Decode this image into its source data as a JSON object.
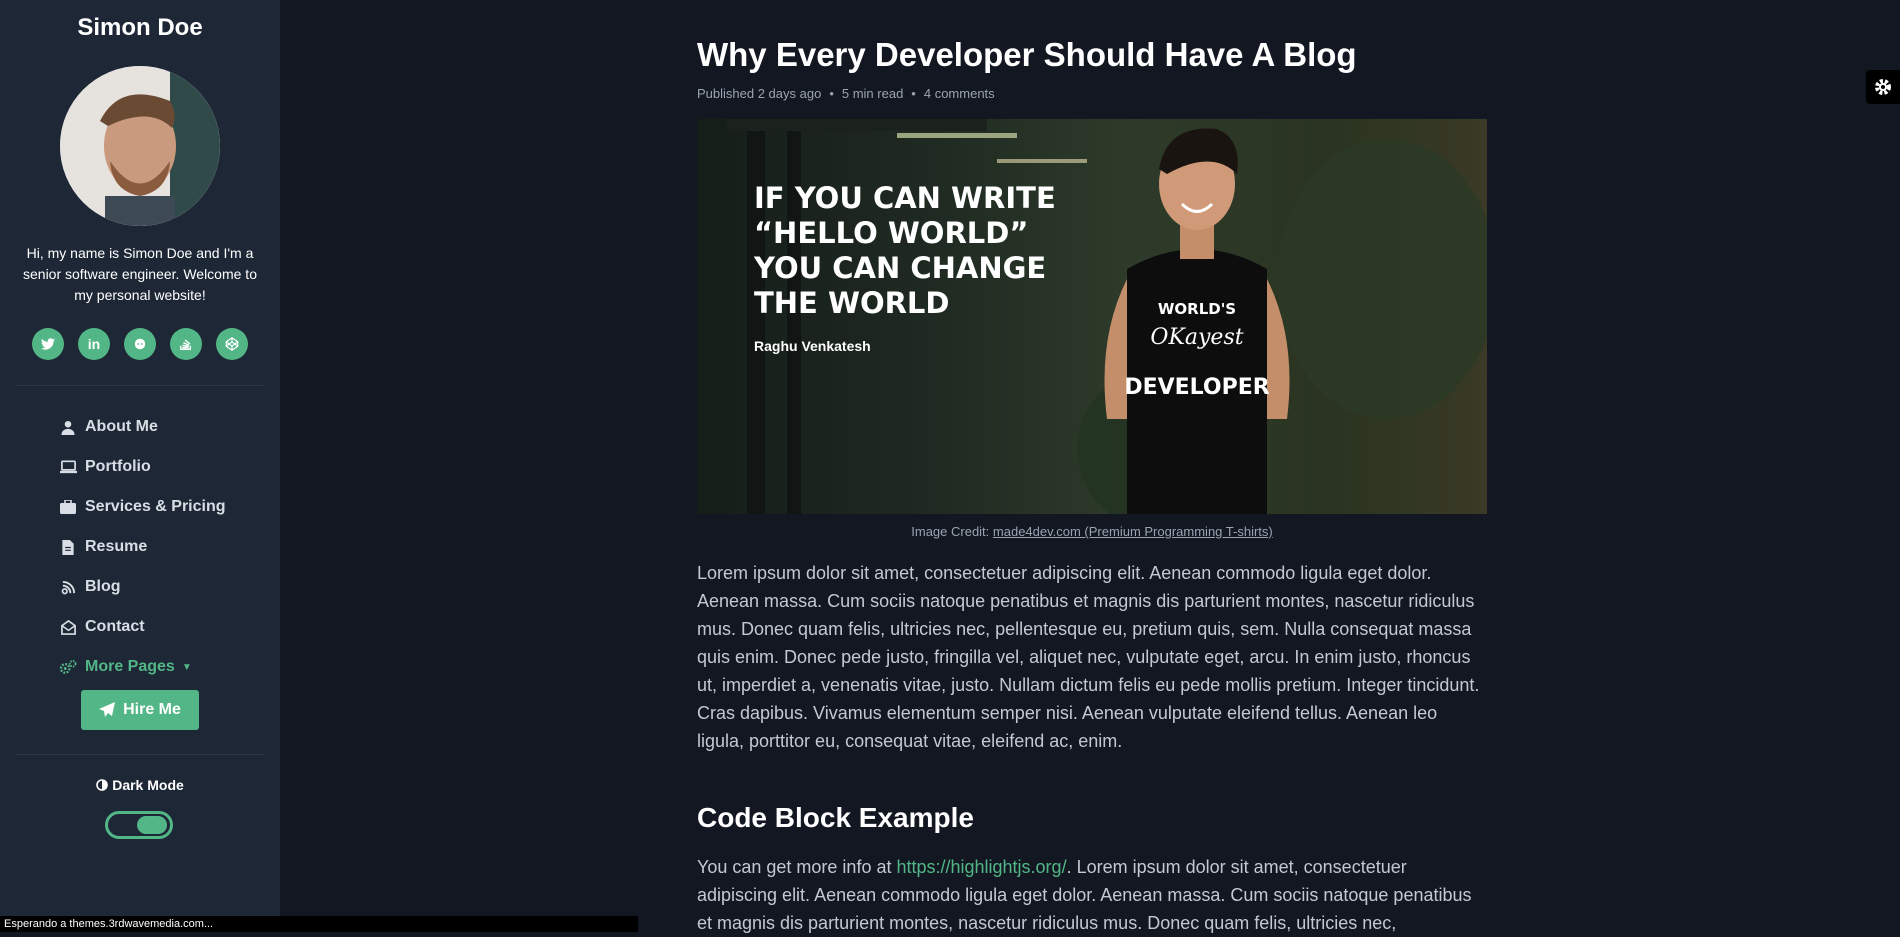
{
  "sidebar": {
    "name": "Simon Doe",
    "bio": "Hi, my name is Simon Doe and I'm a senior software engineer. Welcome to my personal website!",
    "socials": [
      "twitter-icon",
      "linkedin-icon",
      "github-icon",
      "stack-overflow-icon",
      "codepen-icon"
    ],
    "nav": [
      {
        "label": "About Me",
        "icon": "user-icon"
      },
      {
        "label": "Portfolio",
        "icon": "laptop-code-icon"
      },
      {
        "label": "Services & Pricing",
        "icon": "briefcase-icon"
      },
      {
        "label": "Resume",
        "icon": "file-icon"
      },
      {
        "label": "Blog",
        "icon": "blog-icon"
      },
      {
        "label": "Contact",
        "icon": "envelope-open-icon"
      },
      {
        "label": "More Pages",
        "icon": "cogs-icon"
      }
    ],
    "hire_label": "Hire Me",
    "dark_mode_label": "Dark Mode",
    "dark_mode_on": true
  },
  "status_bar": "Esperando a themes.3rdwavemedia.com...",
  "post": {
    "title": "Why Every Developer Should Have A Blog",
    "published": "Published 2 days ago",
    "read_time": "5 min read",
    "comments": "4 comments",
    "hero_quote": "IF YOU CAN WRITE “HELLO WORLD” YOU CAN CHANGE THE WORLD",
    "hero_author": "Raghu Venkatesh",
    "credit_prefix": "Image Credit: ",
    "credit_link": "made4dev.com (Premium Programming T-shirts)",
    "paragraph1": "Lorem ipsum dolor sit amet, consectetuer adipiscing elit. Aenean commodo ligula eget dolor. Aenean massa. Cum sociis natoque penatibus et magnis dis parturient montes, nascetur ridiculus mus. Donec quam felis, ultricies nec, pellentesque eu, pretium quis, sem. Nulla consequat massa quis enim. Donec pede justo, fringilla vel, aliquet nec, vulputate eget, arcu. In enim justo, rhoncus ut, imperdiet a, venenatis vitae, justo. Nullam dictum felis eu pede mollis pretium. Integer tincidunt. Cras dapibus. Vivamus elementum semper nisi. Aenean vulputate eleifend tellus. Aenean leo ligula, porttitor eu, consequat vitae, eleifend ac, enim.",
    "heading2": "Code Block Example",
    "p2_prefix": "You can get more info at ",
    "p2_link": "https://highlightjs.org/",
    "p2_rest": ". Lorem ipsum dolor sit amet, consectetuer adipiscing elit. Aenean commodo ligula eget dolor. Aenean massa. Cum sociis natoque penatibus et magnis dis parturient montes, nascetur ridiculus mus. Donec quam felis, ultricies nec,"
  },
  "colors": {
    "accent": "#52b686",
    "sidebar_bg": "#1d2736",
    "page_bg": "#121722"
  }
}
